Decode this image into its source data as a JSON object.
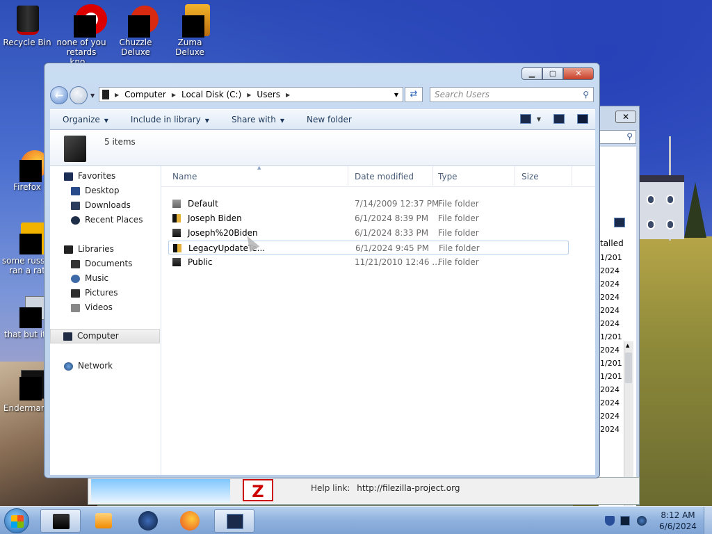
{
  "desktop": {
    "icons": [
      {
        "label": "Recycle Bin"
      },
      {
        "label": "none of you retards kno..."
      },
      {
        "label": "Chuzzle Deluxe"
      },
      {
        "label": "Zuma Deluxe"
      },
      {
        "label": "Firefox"
      },
      {
        "label": "some russia ran a rat"
      },
      {
        "label": "that but its"
      },
      {
        "label": "Endermanc"
      }
    ]
  },
  "background_window": {
    "header_fragment": "talled",
    "dates": [
      "1/201",
      "2024",
      "2024",
      "2024",
      "2024",
      "2024",
      "1/201",
      "2024",
      "1/201",
      "1/201",
      "2024",
      "2024",
      "2024",
      "2024"
    ],
    "help_label": "Help link:",
    "help_url": "http://filezilla-project.org",
    "fz_logo": "Z"
  },
  "explorer": {
    "address": {
      "crumbs": [
        "Computer",
        "Local Disk (C:)",
        "Users"
      ]
    },
    "search_placeholder": "Search Users",
    "toolbar": {
      "organize": "Organize",
      "include": "Include in library",
      "share": "Share with",
      "new_folder": "New folder"
    },
    "item_count": "5 items",
    "nav": {
      "favorites": "Favorites",
      "desktop": "Desktop",
      "downloads": "Downloads",
      "recent": "Recent Places",
      "libraries": "Libraries",
      "documents": "Documents",
      "music": "Music",
      "pictures": "Pictures",
      "videos": "Videos",
      "computer": "Computer",
      "network": "Network"
    },
    "columns": {
      "name": "Name",
      "date": "Date modified",
      "type": "Type",
      "size": "Size"
    },
    "rows": [
      {
        "name": "Default",
        "date": "7/14/2009 12:37 PM",
        "type": "File folder"
      },
      {
        "name": "Joseph Biden",
        "date": "6/1/2024 8:39 PM",
        "type": "File folder"
      },
      {
        "name": "Joseph%20Biden",
        "date": "6/1/2024 8:33 PM",
        "type": "File folder"
      },
      {
        "name": "LegacyUpdateTe...",
        "date": "6/1/2024 9:45 PM",
        "type": "File folder"
      },
      {
        "name": "Public",
        "date": "11/21/2010 12:46 ...",
        "type": "File folder"
      }
    ]
  },
  "taskbar": {
    "time": "8:12 AM",
    "date": "6/6/2024"
  }
}
